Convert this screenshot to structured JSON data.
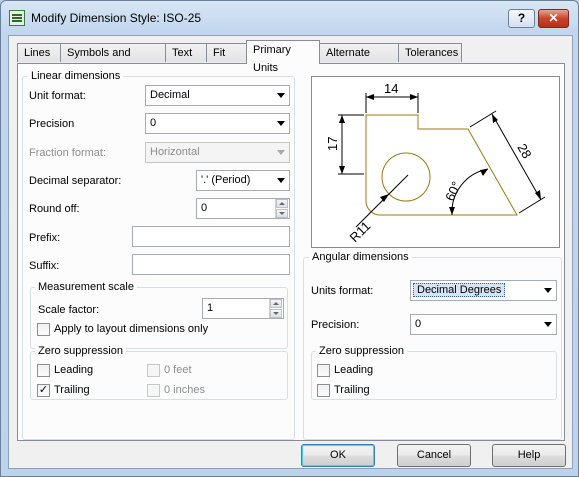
{
  "window": {
    "title": "Modify Dimension Style: ISO-25",
    "help_title_button": "?",
    "close_title_button": "✕"
  },
  "tabs": [
    {
      "label": "Lines"
    },
    {
      "label": "Symbols and Arrows"
    },
    {
      "label": "Text"
    },
    {
      "label": "Fit"
    },
    {
      "label": "Primary Units",
      "active": true
    },
    {
      "label": "Alternate Units"
    },
    {
      "label": "Tolerances"
    }
  ],
  "linear": {
    "legend": "Linear dimensions",
    "unit_format_label": "Unit format:",
    "unit_format_value": "Decimal",
    "precision_label": "Precision",
    "precision_value": "0",
    "fraction_format_label": "Fraction format:",
    "fraction_format_value": "Horizontal",
    "decimal_separator_label": "Decimal separator:",
    "decimal_separator_value": "'.' (Period)",
    "round_off_label": "Round off:",
    "round_off_value": "0",
    "prefix_label": "Prefix:",
    "prefix_value": "",
    "suffix_label": "Suffix:",
    "suffix_value": ""
  },
  "measurement_scale": {
    "legend": "Measurement scale",
    "scale_factor_label": "Scale factor:",
    "scale_factor_value": "1",
    "apply_layout_label": "Apply to layout dimensions only",
    "apply_layout_checked": false
  },
  "zero_suppression_linear": {
    "legend": "Zero suppression",
    "leading_label": "Leading",
    "leading_checked": false,
    "trailing_label": "Trailing",
    "trailing_checked": true,
    "feet_label": "0 feet",
    "inches_label": "0 inches"
  },
  "preview": {
    "dim_14": "14",
    "dim_17": "17",
    "dim_28": "28",
    "dim_60": "60°",
    "dim_r11": "R11"
  },
  "angular": {
    "legend": "Angular dimensions",
    "units_format_label": "Units format:",
    "units_format_value": "Decimal Degrees",
    "precision_label": "Precision:",
    "precision_value": "0"
  },
  "zero_suppression_angular": {
    "legend": "Zero suppression",
    "leading_label": "Leading",
    "leading_checked": false,
    "trailing_label": "Trailing",
    "trailing_checked": false
  },
  "buttons": {
    "ok": "OK",
    "cancel": "Cancel",
    "help": "Help"
  }
}
